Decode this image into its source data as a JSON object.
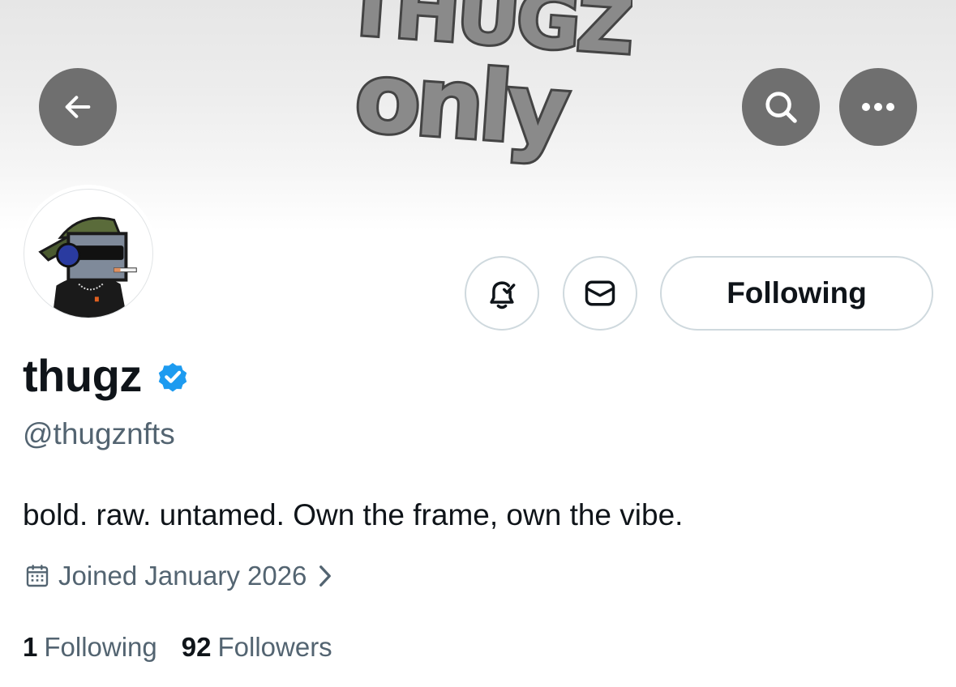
{
  "banner": {
    "art_text_top": "THUGZ",
    "art_text_bottom": "only",
    "back_icon": "arrow-left-icon",
    "search_icon": "search-icon",
    "more_icon": "more-horizontal-icon"
  },
  "actions": {
    "notify_icon": "bell-check-icon",
    "message_icon": "envelope-icon",
    "following_label": "Following"
  },
  "profile": {
    "display_name": "thugz",
    "verified_icon": "verified-badge-icon",
    "verified_color": "#1d9bf0",
    "handle": "@thugznfts",
    "bio": "bold. raw. untamed. Own the frame, own the vibe.",
    "joined": "Joined January 2026",
    "following_count": "1",
    "following_label": "Following",
    "followers_count": "92",
    "followers_label": "Followers"
  },
  "colors": {
    "text_primary": "#0f1419",
    "text_secondary": "#536471",
    "border": "#cfd9de",
    "overlay_button": "#646464"
  }
}
